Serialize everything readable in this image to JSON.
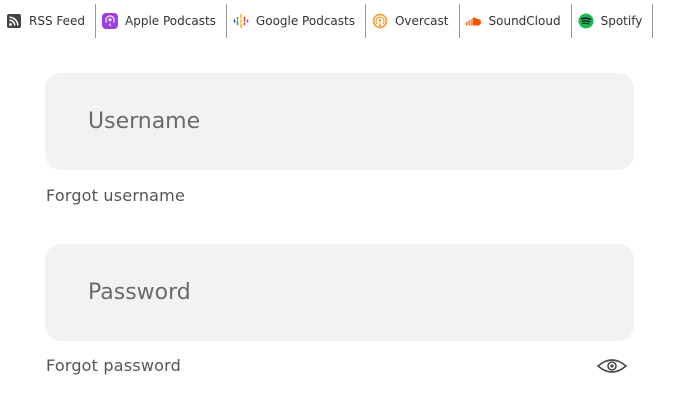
{
  "nav": {
    "items": [
      {
        "label": "RSS Feed",
        "icon": "rss-icon",
        "color": "#444444"
      },
      {
        "label": "Apple Podcasts",
        "icon": "apple-podcasts-icon",
        "color": "#9b3fe0"
      },
      {
        "label": "Google Podcasts",
        "icon": "google-podcasts-icon",
        "color": "#4285f4"
      },
      {
        "label": "Overcast",
        "icon": "overcast-icon",
        "color": "#f59a2d"
      },
      {
        "label": "SoundCloud",
        "icon": "soundcloud-icon",
        "color": "#ff5500"
      },
      {
        "label": "Spotify",
        "icon": "spotify-icon",
        "color": "#1db954"
      }
    ]
  },
  "login": {
    "username": {
      "placeholder": "Username",
      "value": ""
    },
    "forgot_username": "Forgot username",
    "password": {
      "placeholder": "Password",
      "value": ""
    },
    "forgot_password": "Forgot password",
    "show_password_icon": "eye-icon"
  },
  "colors": {
    "field_background": "#f2f2f4",
    "text_muted": "#555555"
  }
}
